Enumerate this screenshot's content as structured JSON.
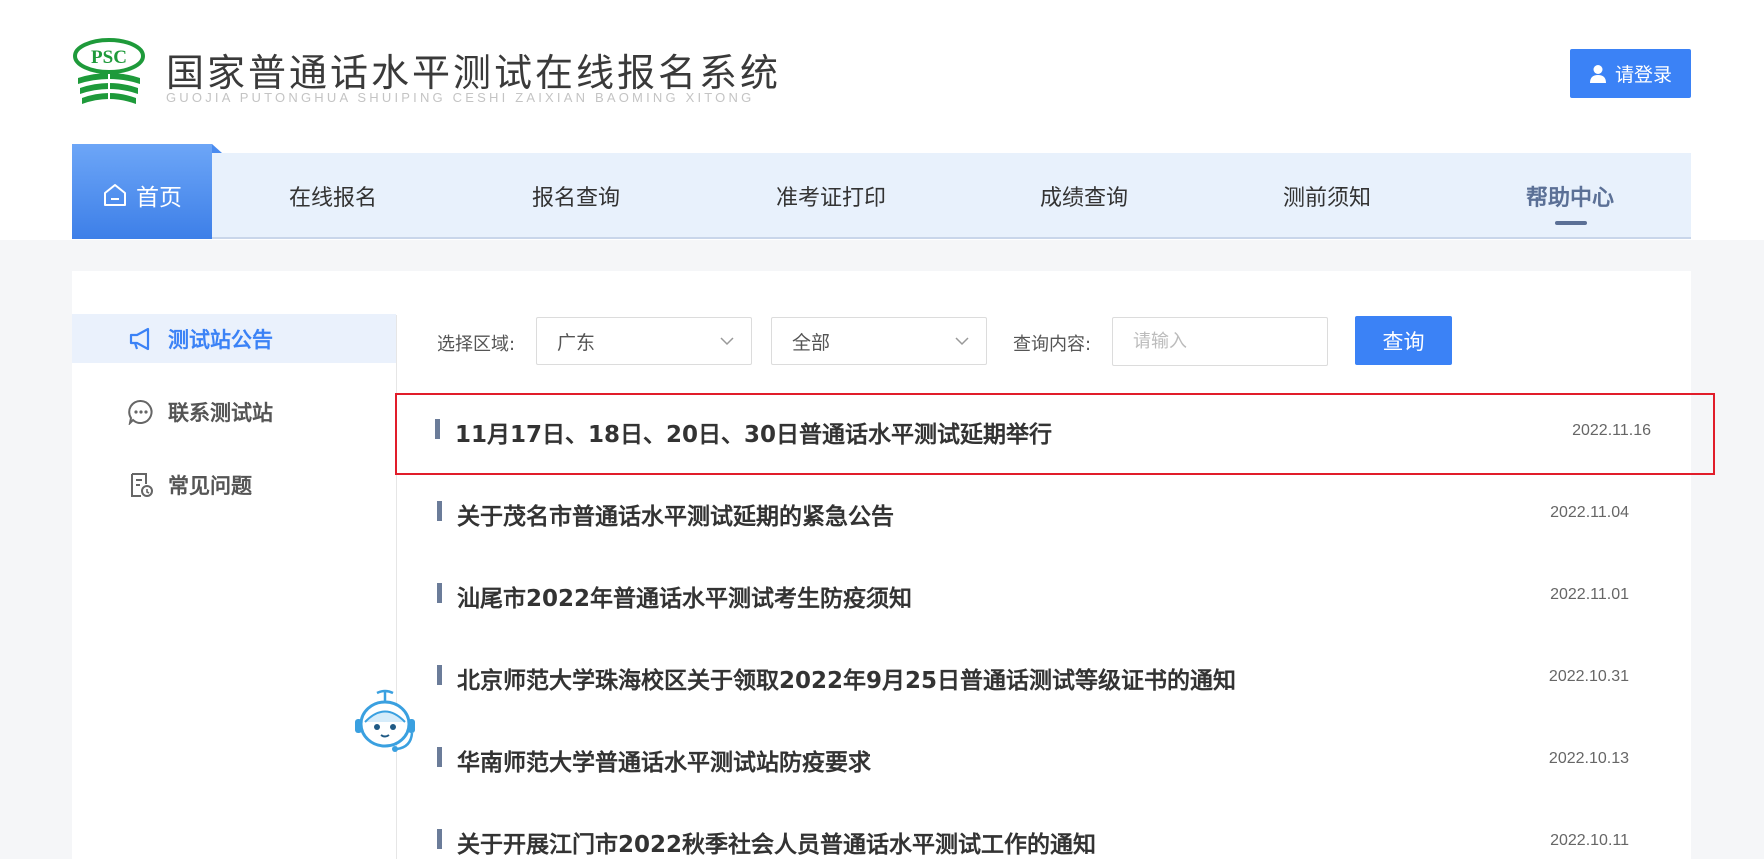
{
  "header": {
    "logo_text": "PSC",
    "title": "国家普通话水平测试在线报名系统",
    "subtitle": "GUOJIA PUTONGHUA SHUIPING CESHI ZAIXIAN BAOMING XITONG",
    "login_label": "请登录",
    "login_icon": "user-icon"
  },
  "nav": {
    "home": "首页",
    "home_icon": "home-icon",
    "items": [
      "在线报名",
      "报名查询",
      "准考证打印",
      "成绩查询",
      "测前须知",
      "帮助中心"
    ],
    "active": "帮助中心"
  },
  "sidebar": {
    "items": [
      {
        "label": "测试站公告",
        "icon": "megaphone-icon",
        "active": true
      },
      {
        "label": "联系测试站",
        "icon": "chat-bubble-icon",
        "active": false
      },
      {
        "label": "常见问题",
        "icon": "document-question-icon",
        "active": false
      }
    ]
  },
  "filter": {
    "region_label": "选择区域:",
    "region_value": "广东",
    "city_value": "全部",
    "query_label": "查询内容:",
    "query_placeholder": "请输入",
    "query_button": "查询"
  },
  "announcements": [
    {
      "title": "11月17日、18日、20日、30日普通话水平测试延期举行",
      "date": "2022.11.16",
      "highlighted": true
    },
    {
      "title": "关于茂名市普通话水平测试延期的紧急公告",
      "date": "2022.11.04"
    },
    {
      "title": "汕尾市2022年普通话水平测试考生防疫须知",
      "date": "2022.11.01"
    },
    {
      "title": "北京师范大学珠海校区关于领取2022年9月25日普通话测试等级证书的通知",
      "date": "2022.10.31"
    },
    {
      "title": "华南师范大学普通话水平测试站防疫要求",
      "date": "2022.10.13"
    },
    {
      "title": "关于开展江门市2022秋季社会人员普通话水平测试工作的通知",
      "date": "2022.10.11"
    }
  ],
  "colors": {
    "accent": "#3b82f6",
    "highlight_border": "#e11d2a",
    "logo_green": "#1e9a3a"
  }
}
